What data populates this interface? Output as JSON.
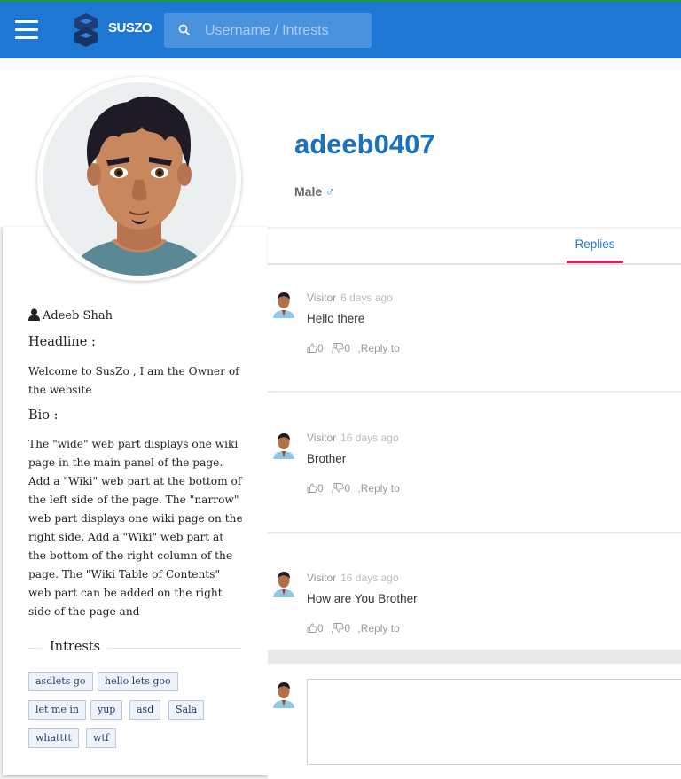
{
  "header": {
    "brand": "SUSZO",
    "search_placeholder": "Username / Intrests",
    "brand_colors": {
      "bar": "#1e77d3",
      "search": "#4b92de",
      "top_line": "#1b9e3e"
    }
  },
  "profile": {
    "username": "adeeb0407",
    "gender": "Male",
    "gender_symbol": "♂",
    "full_name": "Adeeb Shah",
    "headline_label": "Headline :",
    "headline": "Welcome to SusZo , I am the Owner of the website",
    "bio_label": "Bio :",
    "bio": "The \"wide\" web part displays one wiki page in the main panel of the page. Add a \"Wiki\" web part at the bottom of the left side of the page. The \"narrow\" web part displays one wiki page on the right side. Add a \"Wiki\" web part at the bottom of the right column of the page. The \"Wiki Table of Contents\" web part can be added on the right side of the page and",
    "intrests_title": "Intrests",
    "intrests": [
      "asdlets go",
      "hello lets goo",
      "let me in",
      "yup",
      "asd",
      "Sala",
      "whatttt",
      "wtf"
    ]
  },
  "tabs": {
    "replies": "Replies",
    "accent": "#e21f5c"
  },
  "replies": [
    {
      "author": "Visitor",
      "when": "6 days ago",
      "text": "Hello there",
      "likes": "0",
      "dislikes": "0",
      "reply_label": ",Reply to"
    },
    {
      "author": "Visitor",
      "when": "16 days ago",
      "text": "Brother",
      "likes": "0",
      "dislikes": "0",
      "reply_label": ",Reply to"
    },
    {
      "author": "Visitor",
      "when": "16 days ago",
      "text": "How are You Brother",
      "likes": "0",
      "dislikes": "0",
      "reply_label": ",Reply to"
    }
  ],
  "icons": {
    "menu": "menu-icon",
    "logo": "suszo-logo-icon",
    "search": "search-icon",
    "person": "person-icon",
    "thumbs_up": "thumbs-up-icon",
    "thumbs_down": "thumbs-down-icon"
  }
}
